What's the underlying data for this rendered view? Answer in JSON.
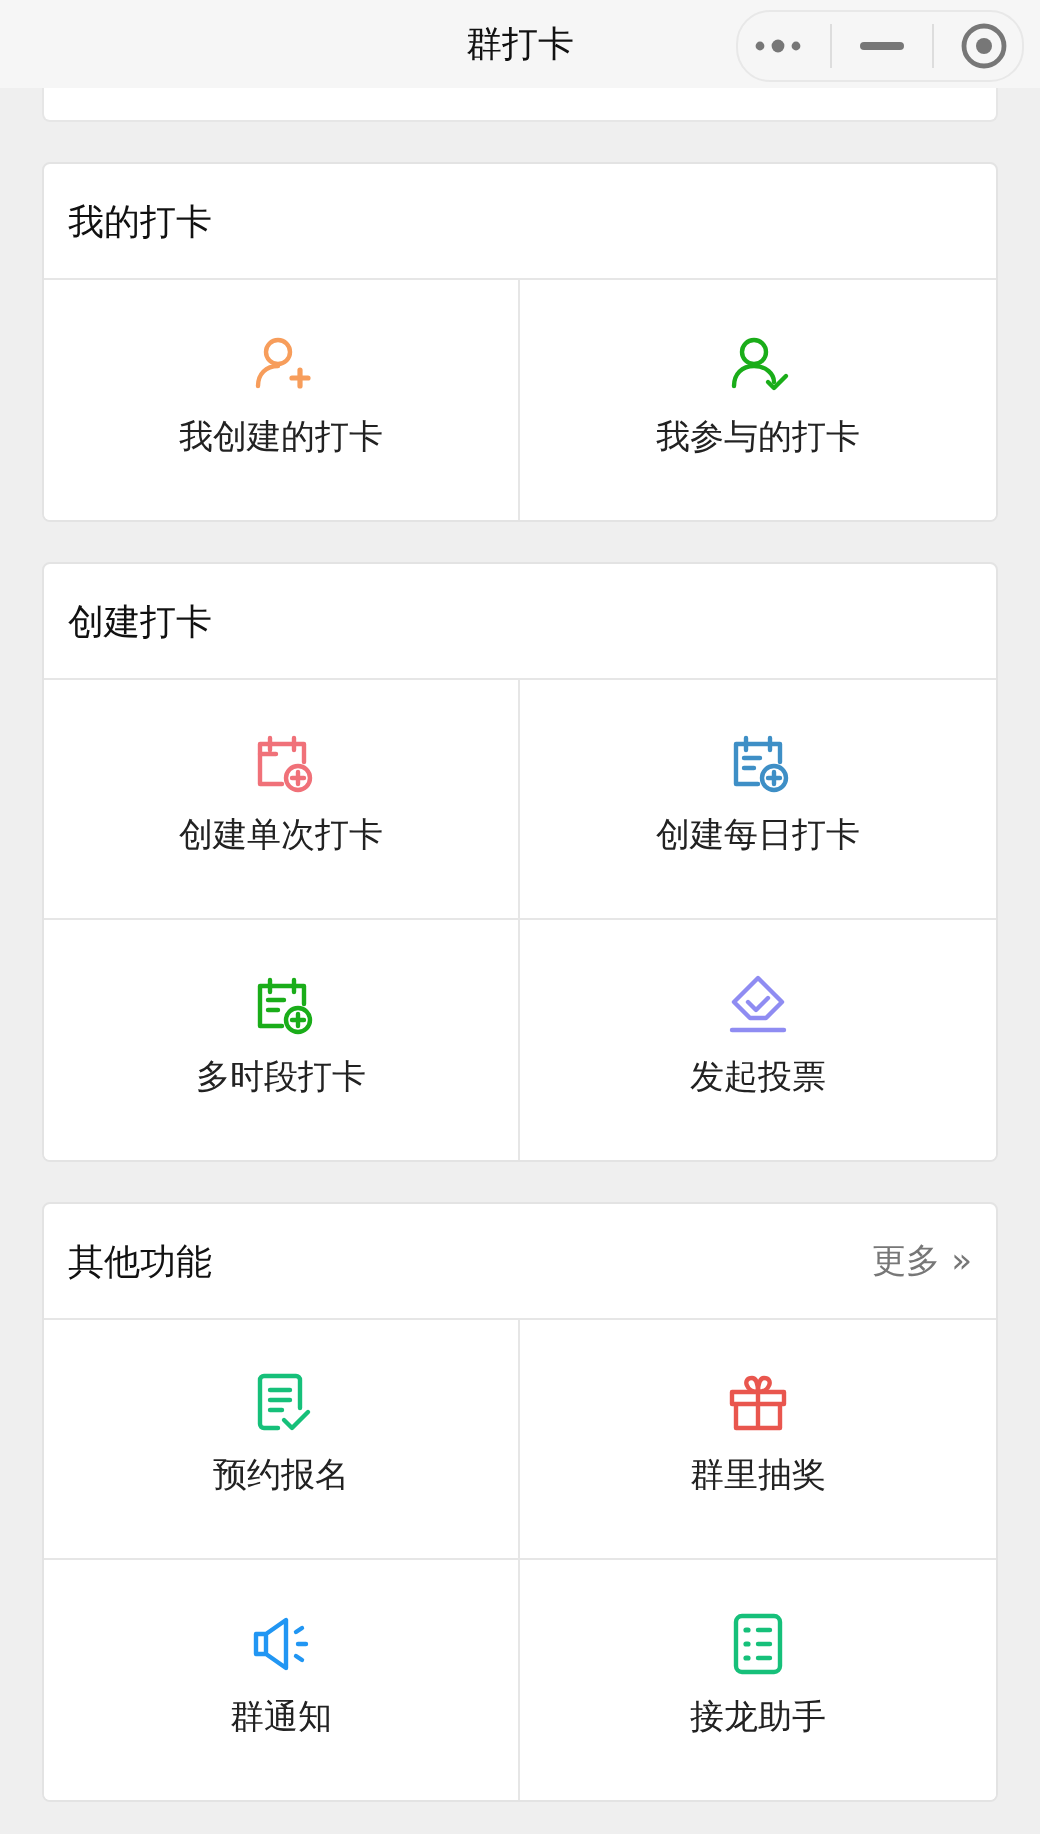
{
  "nav_bar": {
    "title": "群打卡"
  },
  "sections": [
    {
      "title": "我的打卡",
      "items": [
        {
          "label": "我创建的打卡",
          "kind": "person-plus"
        },
        {
          "label": "我参与的打卡",
          "kind": "person-check"
        }
      ]
    },
    {
      "title": "创建打卡",
      "items": [
        {
          "label": "创建单次打卡",
          "kind": "calendar-plus"
        },
        {
          "label": "创建每日打卡",
          "kind": "calendar-list"
        },
        {
          "label": "多时段打卡",
          "kind": "calendar-multi"
        },
        {
          "label": "发起投票",
          "kind": "vote"
        }
      ]
    },
    {
      "title": "其他功能",
      "more": "更多 »",
      "items": [
        {
          "label": "预约报名",
          "kind": "form-check"
        },
        {
          "label": "群里抽奖",
          "kind": "gift"
        },
        {
          "label": "群通知",
          "kind": "speaker"
        },
        {
          "label": "接龙助手",
          "kind": "numbered-list"
        }
      ]
    }
  ]
}
